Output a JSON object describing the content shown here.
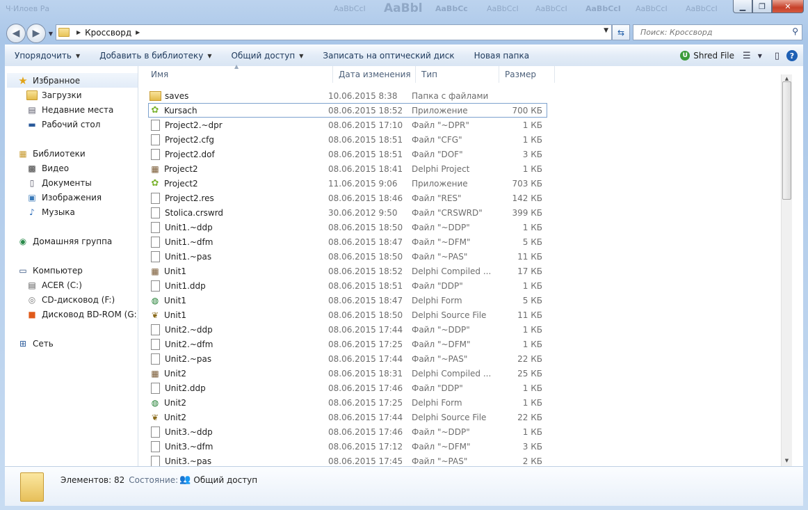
{
  "window": {
    "ghost_title": "Ч·Илоев Ра",
    "ghost_styles": [
      "AaBbCcI",
      "AaBbl",
      "AaBbCc",
      "AaBbCcI",
      "AaBbCcI",
      "AaBbCcI",
      "AaBbCcI",
      "AaBbCcI"
    ]
  },
  "address": {
    "crumb": "Кроссворд",
    "search_placeholder": "Поиск: Кроссворд"
  },
  "toolbar": {
    "organize": "Упорядочить",
    "add_library": "Добавить в библиотеку",
    "share": "Общий доступ",
    "burn": "Записать на оптический диск",
    "new_folder": "Новая папка",
    "shred": "Shred File",
    "shred_badge": "U"
  },
  "nav": {
    "favorites": "Избранное",
    "downloads": "Загрузки",
    "recent": "Недавние места",
    "desktop": "Рабочий стол",
    "libraries": "Библиотеки",
    "video": "Видео",
    "docs": "Документы",
    "images": "Изображения",
    "music": "Музыка",
    "homegroup": "Домашняя группа",
    "computer": "Компьютер",
    "drive_c": "ACER (C:)",
    "drive_f": "CD-дисковод (F:)",
    "drive_g": "Дисковод BD-ROM (G:) O",
    "network": "Сеть"
  },
  "columns": {
    "name": "Имя",
    "date": "Дата изменения",
    "type": "Тип",
    "size": "Размер"
  },
  "files": [
    {
      "name": "saves",
      "date": "10.06.2015 8:38",
      "type": "Папка с файлами",
      "size": "",
      "icon": "folder"
    },
    {
      "name": "Kursach",
      "date": "08.06.2015 18:52",
      "type": "Приложение",
      "size": "700 КБ",
      "icon": "android"
    },
    {
      "name": "Project2.~dpr",
      "date": "08.06.2015 17:10",
      "type": "Файл \"~DPR\"",
      "size": "1 КБ",
      "icon": "file"
    },
    {
      "name": "Project2.cfg",
      "date": "08.06.2015 18:51",
      "type": "Файл \"CFG\"",
      "size": "1 КБ",
      "icon": "file"
    },
    {
      "name": "Project2.dof",
      "date": "08.06.2015 18:51",
      "type": "Файл \"DOF\"",
      "size": "3 КБ",
      "icon": "file"
    },
    {
      "name": "Project2",
      "date": "08.06.2015 18:41",
      "type": "Delphi Project",
      "size": "1 КБ",
      "icon": "delphi"
    },
    {
      "name": "Project2",
      "date": "11.06.2015 9:06",
      "type": "Приложение",
      "size": "703 КБ",
      "icon": "android"
    },
    {
      "name": "Project2.res",
      "date": "08.06.2015 18:46",
      "type": "Файл \"RES\"",
      "size": "142 КБ",
      "icon": "file"
    },
    {
      "name": "Stolica.crswrd",
      "date": "30.06.2012 9:50",
      "type": "Файл \"CRSWRD\"",
      "size": "399 КБ",
      "icon": "file"
    },
    {
      "name": "Unit1.~ddp",
      "date": "08.06.2015 18:50",
      "type": "Файл \"~DDP\"",
      "size": "1 КБ",
      "icon": "file"
    },
    {
      "name": "Unit1.~dfm",
      "date": "08.06.2015 18:47",
      "type": "Файл \"~DFM\"",
      "size": "5 КБ",
      "icon": "file"
    },
    {
      "name": "Unit1.~pas",
      "date": "08.06.2015 18:50",
      "type": "Файл \"~PAS\"",
      "size": "11 КБ",
      "icon": "file"
    },
    {
      "name": "Unit1",
      "date": "08.06.2015 18:52",
      "type": "Delphi Compiled ...",
      "size": "17 КБ",
      "icon": "delphi"
    },
    {
      "name": "Unit1.ddp",
      "date": "08.06.2015 18:51",
      "type": "Файл \"DDP\"",
      "size": "1 КБ",
      "icon": "file"
    },
    {
      "name": "Unit1",
      "date": "08.06.2015 18:47",
      "type": "Delphi Form",
      "size": "5 КБ",
      "icon": "form"
    },
    {
      "name": "Unit1",
      "date": "08.06.2015 18:50",
      "type": "Delphi Source File",
      "size": "11 КБ",
      "icon": "src"
    },
    {
      "name": "Unit2.~ddp",
      "date": "08.06.2015 17:44",
      "type": "Файл \"~DDP\"",
      "size": "1 КБ",
      "icon": "file"
    },
    {
      "name": "Unit2.~dfm",
      "date": "08.06.2015 17:25",
      "type": "Файл \"~DFM\"",
      "size": "1 КБ",
      "icon": "file"
    },
    {
      "name": "Unit2.~pas",
      "date": "08.06.2015 17:44",
      "type": "Файл \"~PAS\"",
      "size": "22 КБ",
      "icon": "file"
    },
    {
      "name": "Unit2",
      "date": "08.06.2015 18:31",
      "type": "Delphi Compiled ...",
      "size": "25 КБ",
      "icon": "delphi"
    },
    {
      "name": "Unit2.ddp",
      "date": "08.06.2015 17:46",
      "type": "Файл \"DDP\"",
      "size": "1 КБ",
      "icon": "file"
    },
    {
      "name": "Unit2",
      "date": "08.06.2015 17:25",
      "type": "Delphi Form",
      "size": "1 КБ",
      "icon": "form"
    },
    {
      "name": "Unit2",
      "date": "08.06.2015 17:44",
      "type": "Delphi Source File",
      "size": "22 КБ",
      "icon": "src"
    },
    {
      "name": "Unit3.~ddp",
      "date": "08.06.2015 17:46",
      "type": "Файл \"~DDP\"",
      "size": "1 КБ",
      "icon": "file"
    },
    {
      "name": "Unit3.~dfm",
      "date": "08.06.2015 17:12",
      "type": "Файл \"~DFM\"",
      "size": "3 КБ",
      "icon": "file"
    },
    {
      "name": "Unit3.~pas",
      "date": "08.06.2015 17:45",
      "type": "Файл \"~PAS\"",
      "size": "2 КБ",
      "icon": "file"
    }
  ],
  "status": {
    "items_label": "Элементов: 82",
    "state_label": "Состояние:",
    "state_value": "Общий доступ"
  },
  "colors": {
    "accent": "#1e395b",
    "selection": "#7da2ce",
    "frame": "#bcd3ee"
  }
}
